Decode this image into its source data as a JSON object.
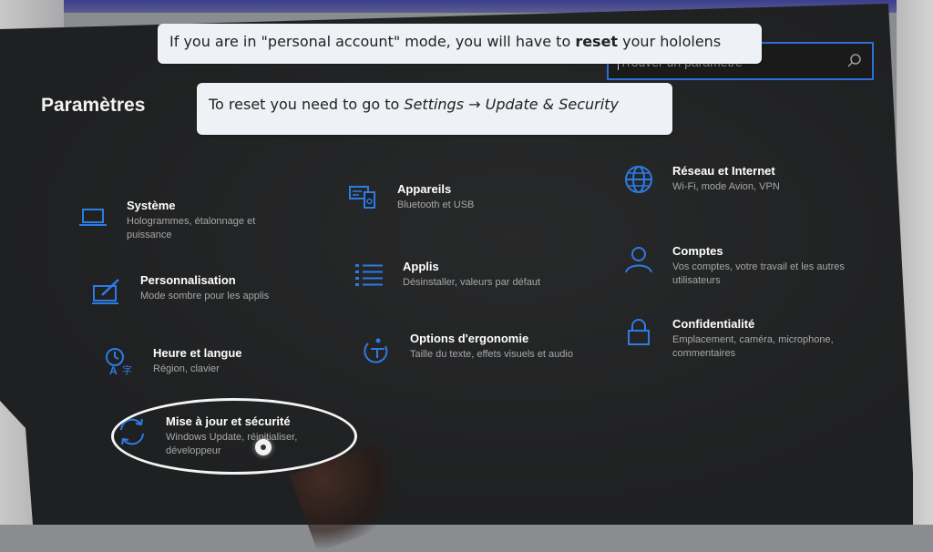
{
  "tooltips": {
    "reset_notice": {
      "prefix": "If you are in \"personal account\" mode, you will have to ",
      "bold": "reset",
      "suffix": " your hololens"
    },
    "reset_path": {
      "prefix": "To reset you need to go to ",
      "path": "Settings → Update & Security"
    }
  },
  "settings": {
    "title": "Paramètres",
    "search": {
      "placeholder": "Trouver un paramètre",
      "icon": "search-icon"
    },
    "accent_color": "#2d7be5",
    "categories": [
      {
        "name": "Système",
        "description": "Hologrammes, étalonnage et puissance",
        "icon": "laptop-icon"
      },
      {
        "name": "Appareils",
        "description": "Bluetooth et USB",
        "icon": "devices-icon"
      },
      {
        "name": "Réseau et Internet",
        "description": "Wi-Fi, mode Avion, VPN",
        "icon": "globe-icon"
      },
      {
        "name": "Personnalisation",
        "description": "Mode sombre pour les applis",
        "icon": "paint-icon"
      },
      {
        "name": "Applis",
        "description": "Désinstaller, valeurs par défaut",
        "icon": "apps-list-icon"
      },
      {
        "name": "Comptes",
        "description": "Vos comptes, votre travail et les autres utilisateurs",
        "icon": "person-icon"
      },
      {
        "name": "Heure et langue",
        "description": "Région, clavier",
        "icon": "time-language-icon"
      },
      {
        "name": "Options d'ergonomie",
        "description": "Taille du texte, effets visuels et audio",
        "icon": "ease-of-access-icon"
      },
      {
        "name": "Confidentialité",
        "description": "Emplacement, caméra, microphone, commentaires",
        "icon": "lock-icon"
      },
      {
        "name": "Mise à jour et sécurité",
        "description": "Windows Update, réinitialiser, développeur",
        "icon": "sync-icon"
      }
    ]
  }
}
